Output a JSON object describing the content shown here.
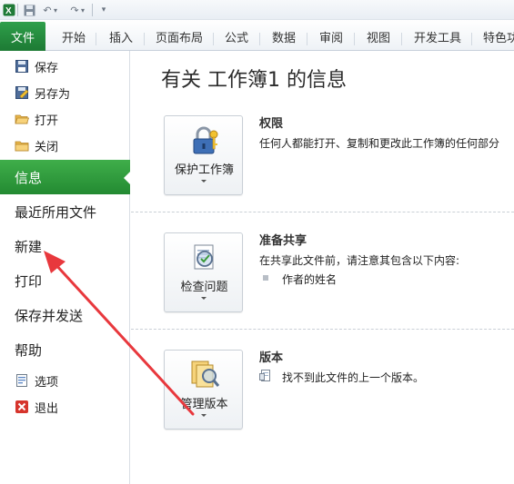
{
  "quick_access": {
    "icons": [
      "excel-app-icon",
      "save-icon",
      "undo-icon",
      "redo-icon",
      "customize-toolbar-icon"
    ]
  },
  "ribbon": {
    "file_tab": "文件",
    "tabs": [
      "开始",
      "插入",
      "页面布局",
      "公式",
      "数据",
      "审阅",
      "视图",
      "开发工具",
      "特色功"
    ]
  },
  "nav": {
    "save": "保存",
    "save_as": "另存为",
    "open": "打开",
    "close": "关闭",
    "info": "信息",
    "recent": "最近所用文件",
    "new": "新建",
    "print": "打印",
    "save_send": "保存并发送",
    "help": "帮助",
    "options": "选项",
    "exit": "退出"
  },
  "info": {
    "title": "有关 工作簿1 的信息",
    "permissions": {
      "button": "保护工作簿",
      "title": "权限",
      "description": "任何人都能打开、复制和更改此工作簿的任何部分"
    },
    "prepare": {
      "button": "检查问题",
      "title": "准备共享",
      "description": "在共享此文件前，请注意其包含以下内容:",
      "items": [
        "作者的姓名"
      ]
    },
    "versions": {
      "button": "管理版本",
      "title": "版本",
      "description": "找不到此文件的上一个版本。"
    }
  },
  "colors": {
    "accent_green": "#2e9f4a",
    "annotation_red": "#e8383d"
  }
}
